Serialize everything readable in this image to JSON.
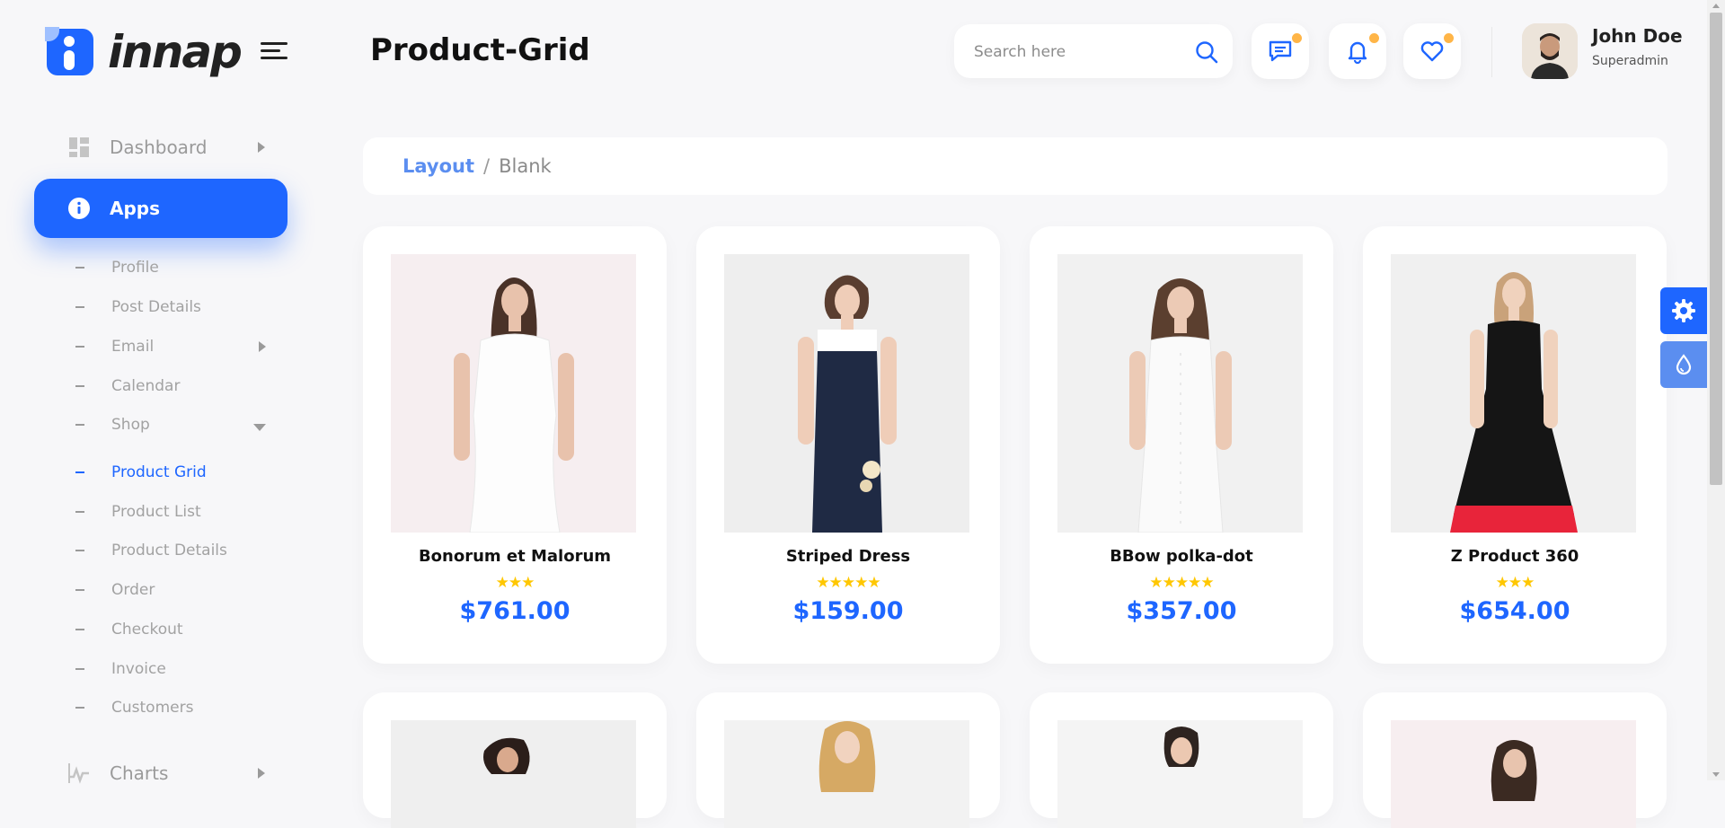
{
  "brand": {
    "name": "innap"
  },
  "sidebar": {
    "main_items": [
      {
        "label": "Dashboard",
        "icon": "dashboard-icon"
      },
      {
        "label": "Apps",
        "icon": "info-icon",
        "active": true
      },
      {
        "label": "Charts",
        "icon": "chart-icon"
      }
    ],
    "sub_items": [
      {
        "label": "Profile"
      },
      {
        "label": "Post Details"
      },
      {
        "label": "Email",
        "has_submenu": true
      },
      {
        "label": "Calendar"
      },
      {
        "label": "Shop",
        "expanded": true
      },
      {
        "label": "Product Grid",
        "active": true
      },
      {
        "label": "Product List"
      },
      {
        "label": "Product Details"
      },
      {
        "label": "Order"
      },
      {
        "label": "Checkout"
      },
      {
        "label": "Invoice"
      },
      {
        "label": "Customers"
      }
    ]
  },
  "header": {
    "title": "Product-Grid",
    "search_placeholder": "Search here",
    "icons": [
      "chat-icon",
      "bell-icon",
      "heart-icon"
    ],
    "user": {
      "name": "John Doe",
      "role": "Superadmin"
    }
  },
  "breadcrumb": {
    "parent": "Layout",
    "separator": "/",
    "current": "Blank"
  },
  "products": [
    {
      "name": "Bonorum et Malorum",
      "rating": 3,
      "price": "$761.00"
    },
    {
      "name": "Striped Dress",
      "rating": 5,
      "price": "$159.00"
    },
    {
      "name": "BBow polka-dot",
      "rating": 5,
      "price": "$357.00"
    },
    {
      "name": "Z Product 360",
      "rating": 3,
      "price": "$654.00"
    }
  ],
  "colors": {
    "accent": "#1e66ff",
    "accent_light": "#5b8ef0",
    "star": "#ffc700",
    "badge": "#ffb547"
  }
}
